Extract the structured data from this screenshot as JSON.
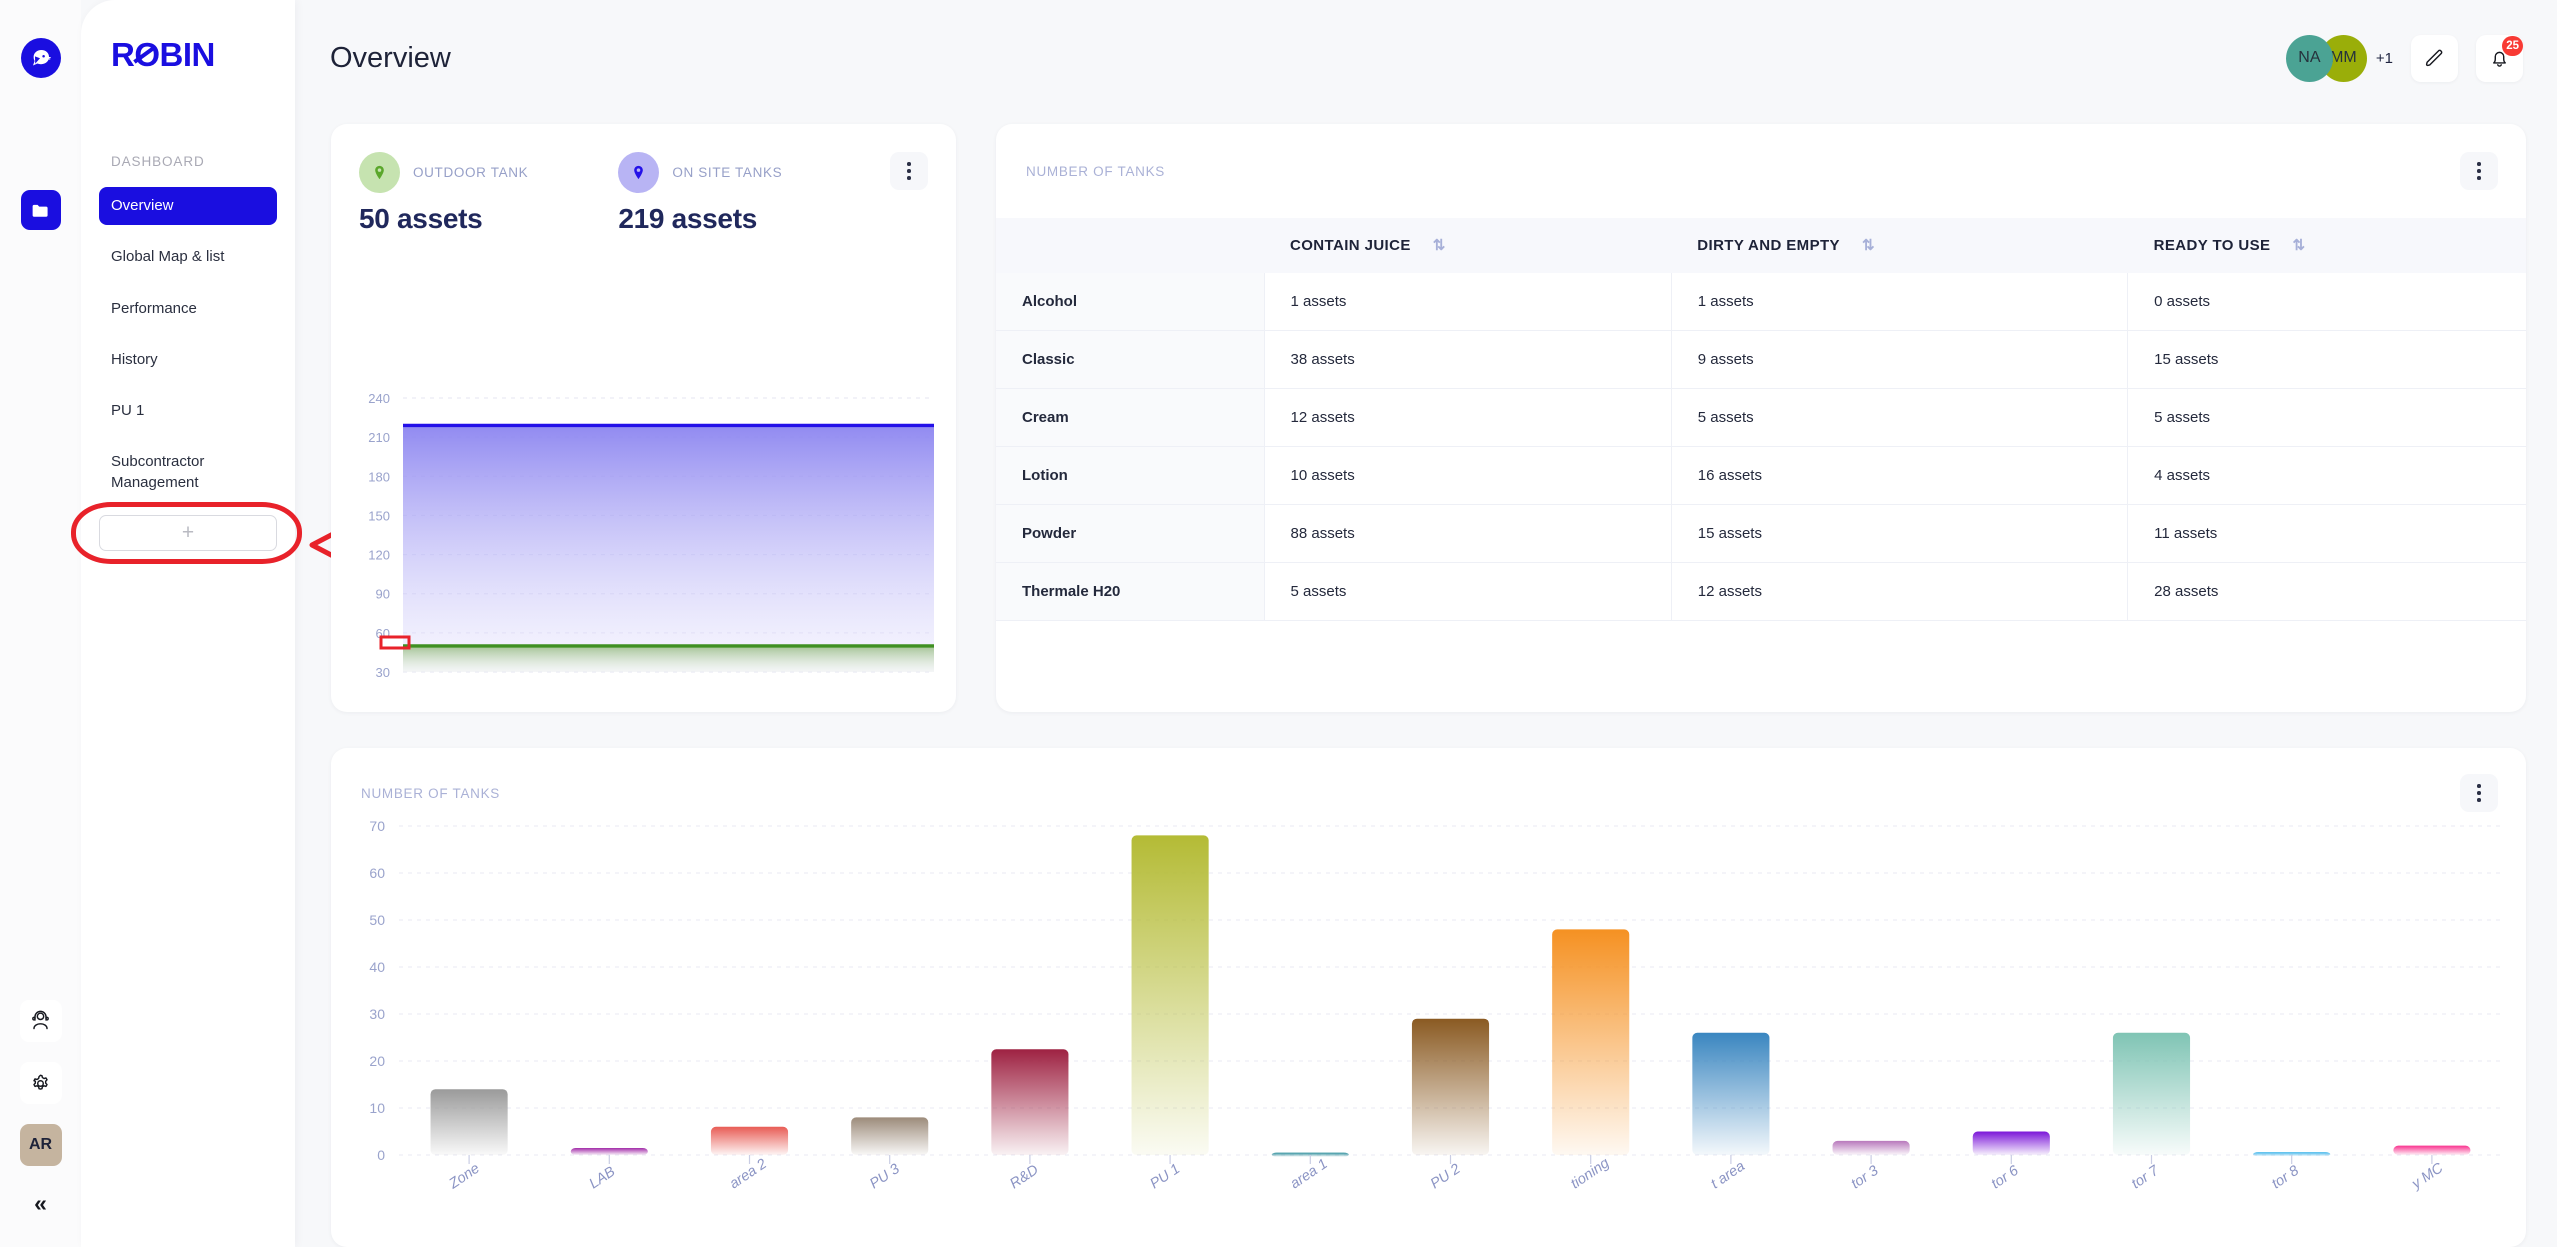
{
  "app": {
    "brand": "ROBIN",
    "accent_color": "#1a0ee0"
  },
  "rail": {
    "logo_icon": "robin-bird-logo-icon",
    "folder_icon": "folder-icon",
    "support_icon": "headset-support-icon",
    "settings_icon": "gear-icon",
    "user_initials": "AR",
    "collapse_icon": "chevron-double-left-icon",
    "collapse_glyph": "«"
  },
  "sidebar": {
    "section_label": "DASHBOARD",
    "items": [
      {
        "label": "Overview",
        "active": true
      },
      {
        "label": "Global Map & list",
        "active": false
      },
      {
        "label": "Performance",
        "active": false
      },
      {
        "label": "History",
        "active": false
      },
      {
        "label": "PU 1",
        "active": false
      },
      {
        "label": "Subcontractor Management",
        "active": false
      }
    ],
    "add_button_label": "+",
    "annotation": {
      "type": "red-ellipse-and-arrow",
      "color": "#e8222a",
      "target": "add-dashboard-button"
    }
  },
  "header": {
    "title": "Overview",
    "avatars": [
      {
        "initials": "NA",
        "color": "#4ba394"
      },
      {
        "initials": "MM",
        "color": "#9aae09"
      }
    ],
    "avatar_overflow": "+1",
    "edit_icon": "pencil-edit-icon",
    "notification_icon": "bell-icon",
    "notification_count": "25",
    "notification_color": "#f83a34"
  },
  "tanks_card": {
    "outdoor": {
      "label": "OUTDOOR TANK",
      "value": "50 assets",
      "icon": "location-pin-icon",
      "color": "#5aa72b"
    },
    "onsite": {
      "label": "ON SITE TANKS",
      "value": "219 assets",
      "icon": "location-pin-icon",
      "color": "#2310e8"
    },
    "kebab_icon": "more-vertical-icon"
  },
  "table_card": {
    "label": "NUMBER OF TANKS",
    "kebab_icon": "more-vertical-icon",
    "sort_glyph": "⇅",
    "columns": [
      "",
      "CONTAIN JUICE",
      "DIRTY AND EMPTY",
      "READY TO USE"
    ],
    "rows": [
      {
        "name": "Alcohol",
        "contain_juice": "1 assets",
        "dirty_and_empty": "1 assets",
        "ready_to_use": "0 assets"
      },
      {
        "name": "Classic",
        "contain_juice": "38 assets",
        "dirty_and_empty": "9 assets",
        "ready_to_use": "15 assets"
      },
      {
        "name": "Cream",
        "contain_juice": "12 assets",
        "dirty_and_empty": "5 assets",
        "ready_to_use": "5 assets"
      },
      {
        "name": "Lotion",
        "contain_juice": "10 assets",
        "dirty_and_empty": "16 assets",
        "ready_to_use": "4 assets"
      },
      {
        "name": "Powder",
        "contain_juice": "88 assets",
        "dirty_and_empty": "15 assets",
        "ready_to_use": "11 assets"
      },
      {
        "name": "Thermale H20",
        "contain_juice": "5 assets",
        "dirty_and_empty": "12 assets",
        "ready_to_use": "28 assets"
      }
    ]
  },
  "bars_card": {
    "label": "NUMBER OF TANKS",
    "kebab_icon": "more-vertical-icon"
  },
  "chart_data": [
    {
      "id": "area-chart-tanks",
      "type": "area",
      "title": "",
      "xlabel": "",
      "ylabel": "",
      "ylim": [
        30,
        240
      ],
      "yticks": [
        30,
        60,
        90,
        120,
        150,
        180,
        210,
        240
      ],
      "grid": true,
      "legend_position": "none",
      "x": [
        0,
        1
      ],
      "series": [
        {
          "name": "ON SITE TANKS",
          "values": [
            219,
            219
          ],
          "line_color": "#2310e8",
          "fill_from": "#8b84f0",
          "fill_to": "#e9e7fd"
        },
        {
          "name": "OUTDOOR TANK",
          "values": [
            50,
            50
          ],
          "line_color": "#3f9022",
          "fill_from": "#9ec08d",
          "fill_to": "#eef4ea"
        }
      ]
    },
    {
      "id": "bar-chart-tanks-by-area",
      "type": "bar",
      "title": "NUMBER OF TANKS",
      "xlabel": "",
      "ylabel": "",
      "ylim": [
        0,
        70
      ],
      "yticks": [
        0,
        10,
        20,
        30,
        40,
        50,
        60,
        70
      ],
      "grid": true,
      "legend_position": "none",
      "categories": [
        "Zone",
        "LAB",
        "area 2",
        "PU 3",
        "R&D",
        "PU 1",
        "area 1",
        "PU 2",
        "tioning",
        "t area",
        "tor 3",
        "tor 6",
        "tor 7",
        "tor 8",
        "y MC"
      ],
      "values": [
        14,
        1.5,
        6,
        8,
        22.5,
        68,
        0.5,
        29,
        48,
        26,
        3,
        5,
        26,
        0.6,
        2
      ],
      "colors": [
        "#9a9a9a",
        "#a12aa8",
        "#e85c55",
        "#9c8b7a",
        "#9e2242",
        "#b4bb35",
        "#2f8f9c",
        "#8a5a22",
        "#f59122",
        "#3a86c0",
        "#b878bc",
        "#7b16d8",
        "#7fc4b4",
        "#3fb5ea",
        "#f9318e"
      ]
    }
  ]
}
